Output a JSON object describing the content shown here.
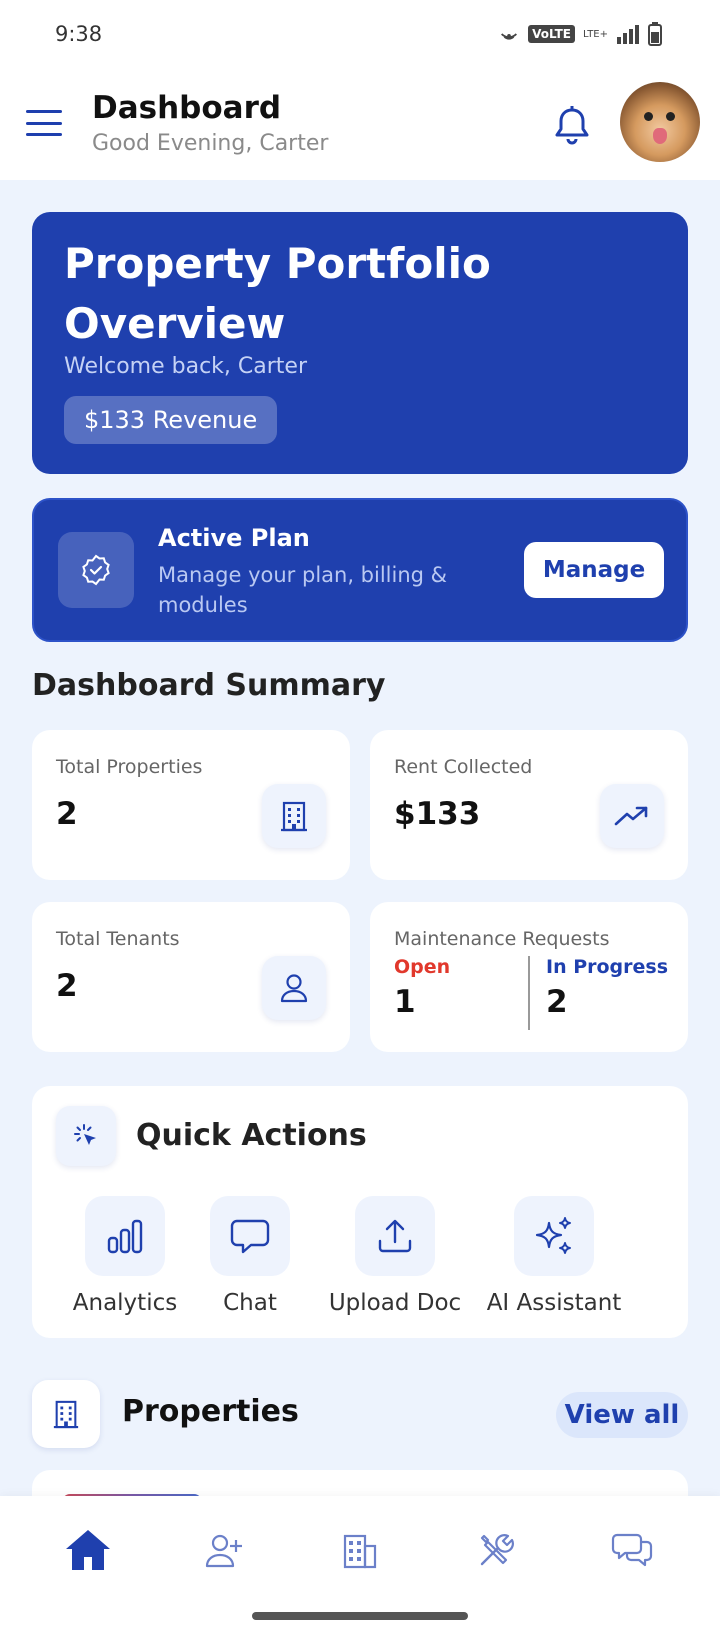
{
  "status_bar": {
    "time": "9:38",
    "volte": "VoLTE",
    "lte": "LTE+"
  },
  "header": {
    "title": "Dashboard",
    "greeting": "Good Evening, Carter"
  },
  "hero": {
    "title": "Property Portfolio Overview",
    "welcome": "Welcome back, Carter",
    "revenue_badge": "$133 Revenue"
  },
  "plan": {
    "title": "Active Plan",
    "description": "Manage your plan, billing & modules",
    "manage_label": "Manage"
  },
  "summary": {
    "title": "Dashboard Summary",
    "total_properties": {
      "label": "Total Properties",
      "value": "2"
    },
    "rent_collected": {
      "label": "Rent Collected",
      "value": "$133"
    },
    "total_tenants": {
      "label": "Total Tenants",
      "value": "2"
    },
    "maintenance": {
      "label": "Maintenance Requests",
      "open_label": "Open",
      "open_value": "1",
      "progress_label": "In Progress",
      "progress_value": "2"
    }
  },
  "quick_actions": {
    "title": "Quick Actions",
    "items": [
      {
        "label": "Analytics",
        "icon": "bar-chart-icon"
      },
      {
        "label": "Chat",
        "icon": "chat-bubble-icon"
      },
      {
        "label": "Upload Doc",
        "icon": "upload-icon"
      },
      {
        "label": "AI Assistant",
        "icon": "sparkles-icon"
      }
    ]
  },
  "properties": {
    "title": "Properties",
    "view_all": "View all"
  },
  "bottom_nav": [
    {
      "icon": "home-icon",
      "active": true
    },
    {
      "icon": "add-user-icon",
      "active": false
    },
    {
      "icon": "building-icon",
      "active": false
    },
    {
      "icon": "tools-icon",
      "active": false
    },
    {
      "icon": "messages-icon",
      "active": false
    }
  ],
  "colors": {
    "primary": "#1f40ae",
    "background": "#edf3fd",
    "open_red": "#e1382c"
  }
}
